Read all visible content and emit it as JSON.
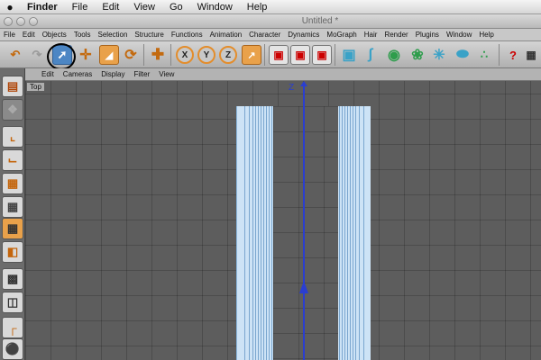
{
  "mac_menubar": {
    "apple": "",
    "items": [
      "Finder",
      "File",
      "Edit",
      "View",
      "Go",
      "Window",
      "Help"
    ]
  },
  "window": {
    "title": "Untitled *"
  },
  "app_menu": {
    "items": [
      "File",
      "Edit",
      "Objects",
      "Tools",
      "Selection",
      "Structure",
      "Functions",
      "Animation",
      "Character",
      "Dynamics",
      "MoGraph",
      "Hair",
      "Render",
      "Plugins",
      "Window",
      "Help"
    ]
  },
  "toolbar": {
    "axis_x": "X",
    "axis_y": "Y",
    "axis_z": "Z"
  },
  "viewport": {
    "menu": [
      "Edit",
      "Cameras",
      "Display",
      "Filter",
      "View"
    ],
    "view_name": "Top",
    "axis_label": "Z"
  },
  "annotations": {
    "arrow": "←"
  }
}
